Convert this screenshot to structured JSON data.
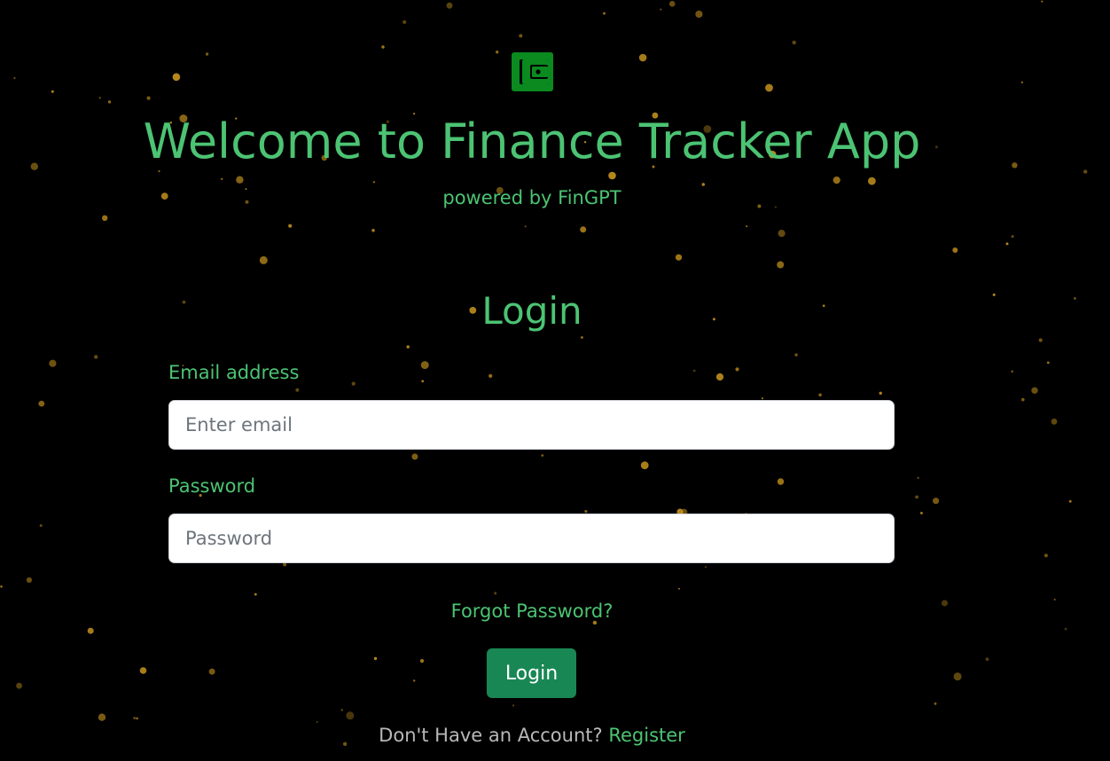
{
  "header": {
    "logo_icon": "wallet-icon",
    "title": "Welcome to Finance Tracker App",
    "subtitle": "powered by FinGPT"
  },
  "login_form": {
    "heading": "Login",
    "email": {
      "label": "Email address",
      "value": "",
      "placeholder": "Enter email"
    },
    "password": {
      "label": "Password",
      "value": "",
      "placeholder": "Password"
    },
    "forgot_password_link": "Forgot Password?",
    "submit_label": "Login",
    "register_prompt": "Don't Have an Account?",
    "register_link": "Register"
  },
  "colors": {
    "background": "#000000",
    "accent_green": "#4cc373",
    "button_green": "#198754",
    "logo_green": "#0b8a1f",
    "star_gold": "#c9961e",
    "muted_text": "#b8b8b8"
  }
}
